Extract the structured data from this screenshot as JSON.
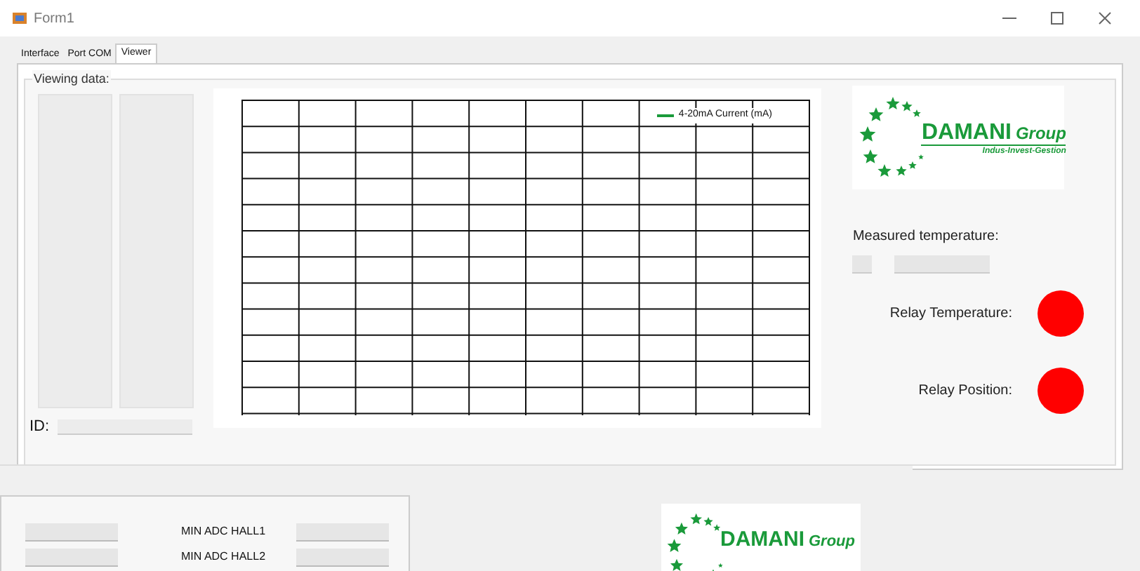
{
  "window": {
    "title": "Form1"
  },
  "tabs": [
    {
      "label": "Interface",
      "selected": false
    },
    {
      "label": "Port COM",
      "selected": false
    },
    {
      "label": "Viewer",
      "selected": true
    }
  ],
  "group": {
    "title": "Viewing data:"
  },
  "id_label": "ID:",
  "chart": {
    "legend": "4-20mA Current (mA)"
  },
  "logo": {
    "name": "DAMANI",
    "suffix": "Group",
    "tagline": "Indus-Invest-Gestion"
  },
  "measured_temperature": {
    "label": "Measured temperature:"
  },
  "indicators": [
    {
      "label": "Relay Temperature:",
      "color": "#ff0000"
    },
    {
      "label": "Relay Position:",
      "color": "#ff0000"
    }
  ],
  "second_window": {
    "rows": [
      {
        "label": "MIN ADC HALL1"
      },
      {
        "label": "MIN ADC HALL2"
      }
    ],
    "logo": {
      "name": "DAMANI",
      "suffix": "Group"
    }
  }
}
